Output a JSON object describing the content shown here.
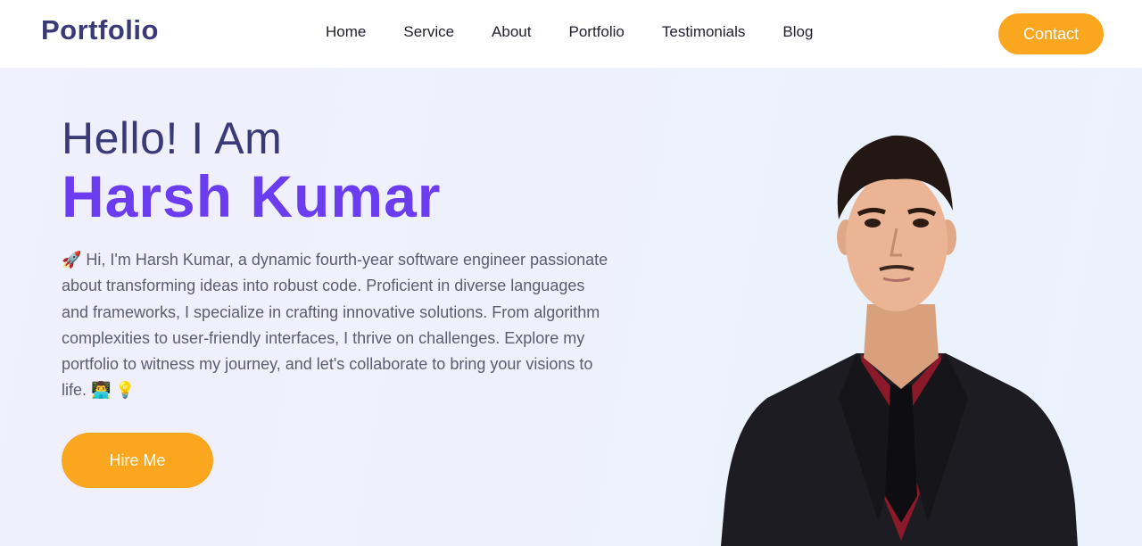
{
  "nav": {
    "logo": "Portfolio",
    "links": [
      "Home",
      "Service",
      "About",
      "Portfolio",
      "Testimonials",
      "Blog"
    ],
    "contact_label": "Contact"
  },
  "hero": {
    "greeting": "Hello! I Am",
    "name": "Harsh Kumar",
    "bio": "🚀 Hi, I'm Harsh Kumar, a dynamic fourth-year software engineer passionate about transforming ideas into robust code. Proficient in diverse languages and frameworks, I specialize in crafting innovative solutions. From algorithm complexities to user-friendly interfaces, I thrive on challenges. Explore my portfolio to witness my journey, and let's collaborate to bring your visions to life. 👨‍💻 💡",
    "hire_label": "Hire Me"
  },
  "colors": {
    "brand": "#3b3a78",
    "accent": "#6b3cf0",
    "button": "#fba61f"
  }
}
